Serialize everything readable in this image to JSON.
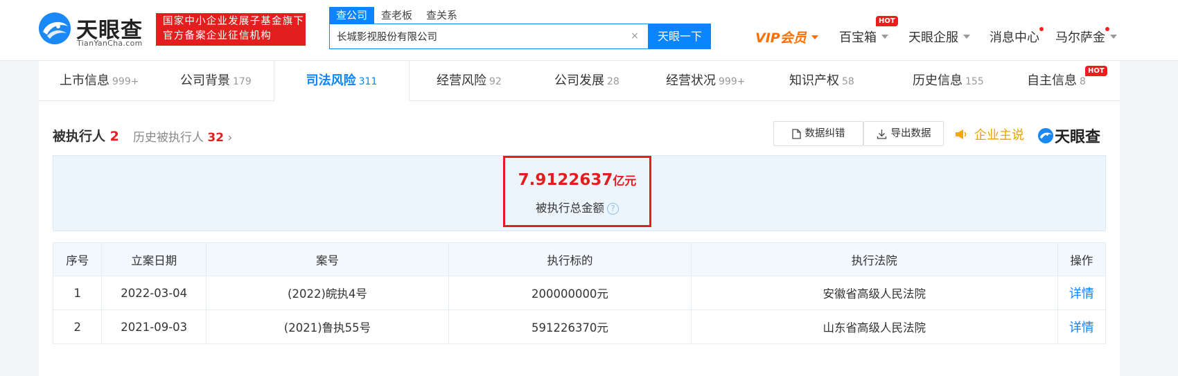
{
  "header": {
    "logo_cn": "天眼查",
    "logo_en": "TianYanCha.com",
    "badge_line1": "国家中小企业发展子基金旗下",
    "badge_line2": "官方备案企业征信机构",
    "search_tabs": [
      "查公司",
      "查老板",
      "查关系"
    ],
    "search_value": "长城影视股份有限公司",
    "search_clear": "×",
    "search_button": "天眼一下",
    "nav": {
      "vip": "VIP会员",
      "treasure": "百宝箱",
      "hot": "HOT",
      "enterprise": "天眼企服",
      "messages": "消息中心",
      "user": "马尔萨金"
    }
  },
  "tabs": [
    {
      "label": "上市信息",
      "count": "999+"
    },
    {
      "label": "公司背景",
      "count": "179"
    },
    {
      "label": "司法风险",
      "count": "311"
    },
    {
      "label": "经营风险",
      "count": "92"
    },
    {
      "label": "公司发展",
      "count": "28"
    },
    {
      "label": "经营状况",
      "count": "999+"
    },
    {
      "label": "知识产权",
      "count": "58"
    },
    {
      "label": "历史信息",
      "count": "155"
    },
    {
      "label": "自主信息",
      "count": "8"
    }
  ],
  "tab_hot": "HOT",
  "section": {
    "title": "被执行人",
    "count": "2",
    "history_label": "历史被执行人",
    "history_count": "32",
    "chevron": "›",
    "correct_btn": "数据纠错",
    "export_btn": "导出数据",
    "zhushuo": "企业主说",
    "brand": "天眼查"
  },
  "summary": {
    "amount": "7.9122637",
    "unit": "亿元",
    "label": "被执行总金额",
    "help": "?"
  },
  "table": {
    "headers": [
      "序号",
      "立案日期",
      "案号",
      "执行标的",
      "执行法院",
      "操作"
    ],
    "rows": [
      [
        "1",
        "2022-03-04",
        "(2022)皖执4号",
        "200000000元",
        "安徽省高级人民法院",
        "详情"
      ],
      [
        "2",
        "2021-09-03",
        "(2021)鲁执55号",
        "591226370元",
        "山东省高级人民法院",
        "详情"
      ]
    ]
  },
  "colors": {
    "primary": "#0a84ff",
    "red": "#e31e1e",
    "vip": "#ff6f00"
  }
}
